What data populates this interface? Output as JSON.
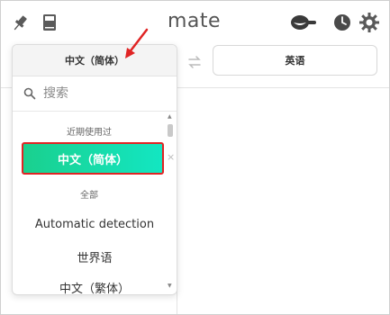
{
  "header": {
    "title": "mate",
    "icons": [
      "pin-icon",
      "book-icon",
      "eye-toggle-icon",
      "clock-icon",
      "gear-icon"
    ]
  },
  "language_bar": {
    "source_lang": "中文（简体）",
    "target_lang": "英语"
  },
  "dropdown": {
    "header_label": "中文（简体）",
    "search_placeholder": "搜索",
    "recent_section_label": "近期使用过",
    "recent_items": [
      {
        "label": "中文（简体）",
        "selected": true
      }
    ],
    "all_section_label": "全部",
    "all_items": [
      {
        "label": "Automatic detection"
      },
      {
        "label": "世界语"
      },
      {
        "label": "中文（繁体）"
      }
    ],
    "close_glyph": "×"
  },
  "colors": {
    "selected_gradient_start": "#1ad08e",
    "selected_gradient_end": "#13e6c2",
    "annotation_red": "#e02424"
  }
}
